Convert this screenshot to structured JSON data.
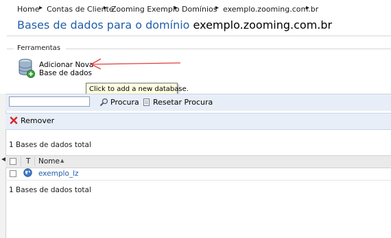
{
  "breadcrumb": {
    "items": [
      "Home",
      "Contas de Cliente",
      "Zooming Exemplo",
      "Domínios",
      "exemplo.zooming.com.br"
    ],
    "separator": "▸"
  },
  "page": {
    "title_prefix": "Bases de dados para o domínio",
    "title_domain": "exemplo.zooming.com.br"
  },
  "tools": {
    "legend": "Ferramentas",
    "add_label_line1": "Adicionar Nova",
    "add_label_line2": "Base de dados",
    "tooltip": "Click to add a new database."
  },
  "search": {
    "value": "",
    "search_label": "Procura",
    "reset_label": "Resetar Procura"
  },
  "actions": {
    "remove_label": "Remover"
  },
  "summary": {
    "total_top": "1 Bases de dados total",
    "total_bottom": "1 Bases de dados total"
  },
  "table": {
    "columns": {
      "type": "T",
      "name": "Nome"
    },
    "rows": [
      {
        "name": "exemplo_lz"
      }
    ]
  },
  "colors": {
    "link": "#1f5fa8",
    "toolbar_bg": "#e8eef7",
    "tooltip_bg": "#ffffe1",
    "annotation_arrow": "#e23b3b"
  },
  "icons": {
    "database": "database-add-icon",
    "search": "magnifier-icon",
    "reset": "reset-page-icon",
    "remove": "red-x-icon",
    "row_type": "globe-icon"
  }
}
